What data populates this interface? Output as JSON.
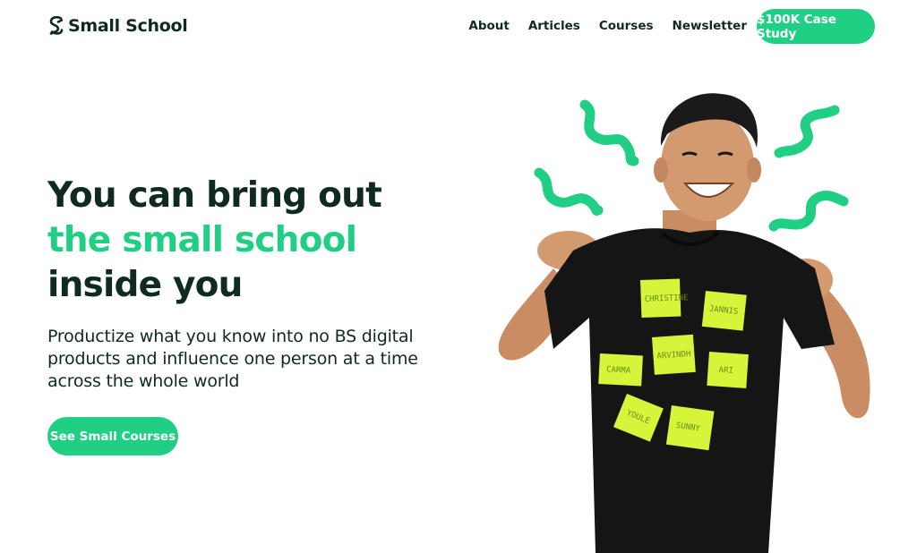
{
  "brand": {
    "name": "Small School",
    "icon": "s-logo-icon",
    "accent_color": "#20cf84",
    "text_color": "#0f2a1f"
  },
  "nav": {
    "items": [
      {
        "label": "About"
      },
      {
        "label": "Articles"
      },
      {
        "label": "Courses"
      },
      {
        "label": "Newsletter"
      }
    ],
    "cta_label": "$100K Case Study"
  },
  "hero": {
    "headline_line1": "You can bring out",
    "headline_line2": "the small school",
    "headline_line3": "inside you",
    "subheadline": "Productize what you know into no BS digital products and influence one person at a time across the whole world",
    "cta_label": "See Small Courses"
  },
  "illustration": {
    "sticky_notes": [
      {
        "text": "CHRISTINE"
      },
      {
        "text": "JANNIS"
      },
      {
        "text": "CARMA"
      },
      {
        "text": "ARVINDH"
      },
      {
        "text": "ARI"
      },
      {
        "text": "YOULE"
      },
      {
        "text": "SUNNY"
      }
    ],
    "note_color": "#d6f53a",
    "squiggle_color": "#20cf84"
  }
}
